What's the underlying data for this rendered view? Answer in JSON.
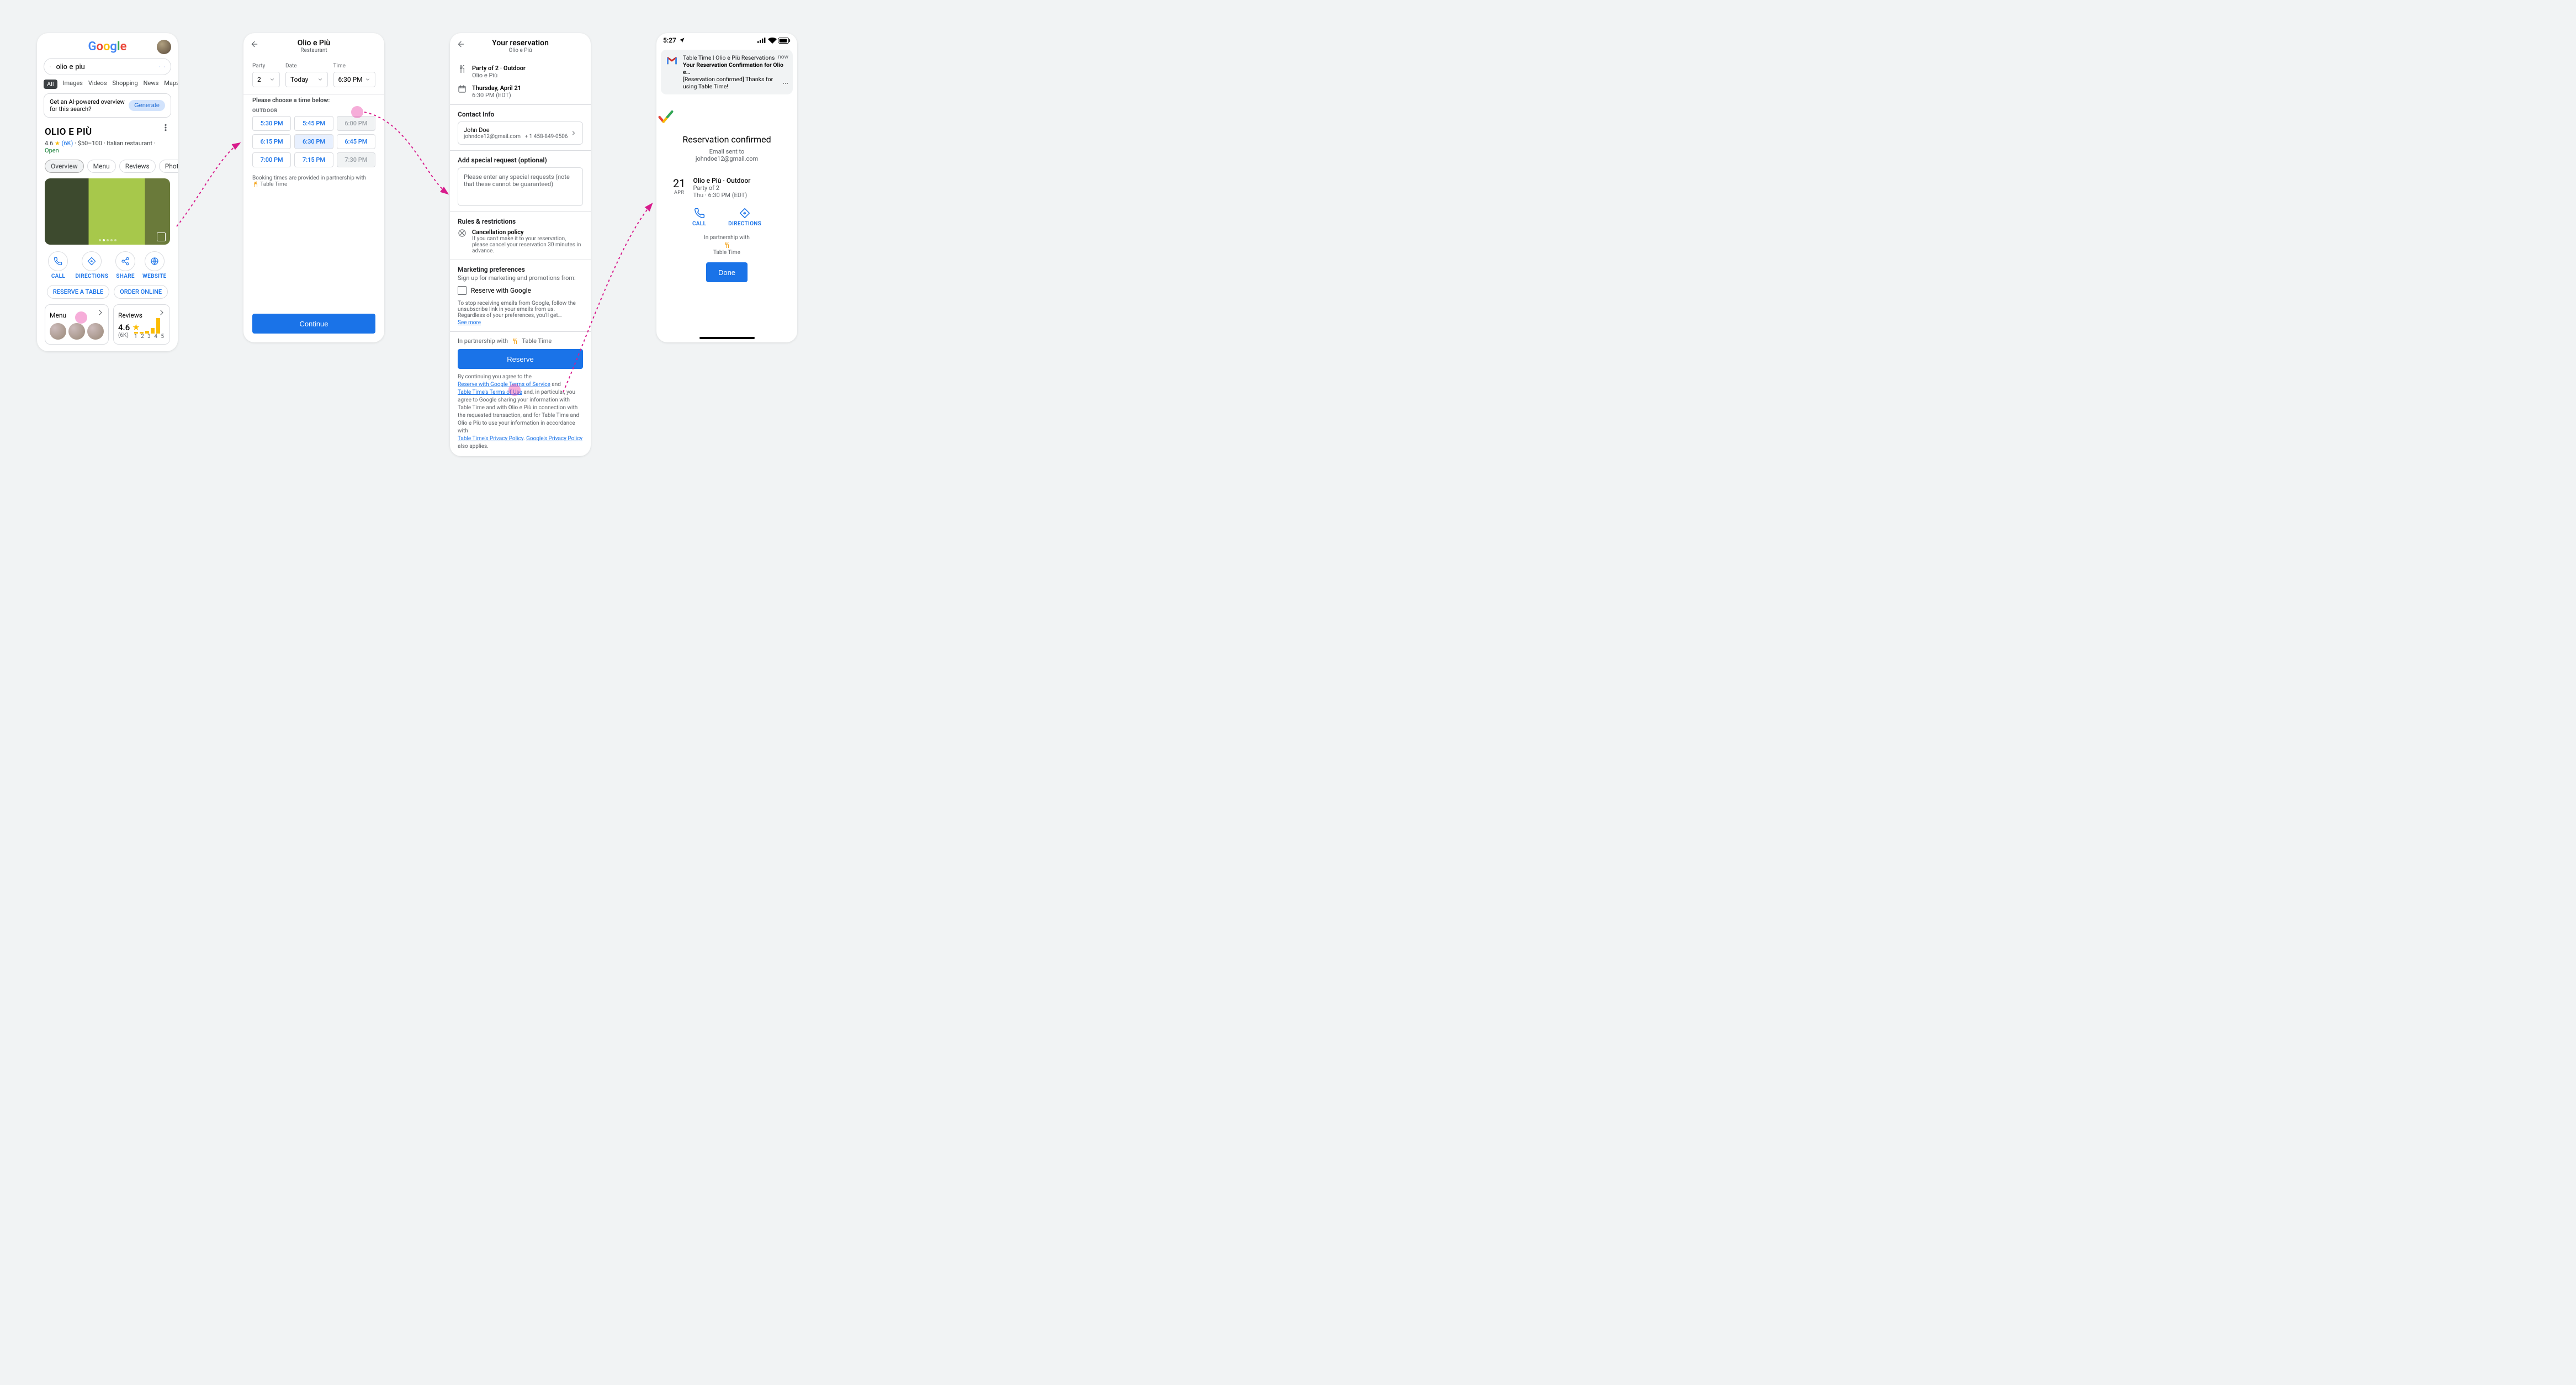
{
  "screens": {
    "search": {
      "query": "olio e piu",
      "tabs": [
        "All",
        "Images",
        "Videos",
        "Shopping",
        "News",
        "Maps"
      ],
      "ai_prompt": "Get an AI-powered overview for this search?",
      "ai_btn": "Generate",
      "name": "OLIO E PIÙ",
      "rating": "4.6",
      "star": "★",
      "reviews": "(6K)",
      "dot1": "·",
      "price": "$50–100",
      "dot2": "·",
      "cuisine": "Italian restaurant",
      "dot3": "·",
      "open": "Open",
      "tab_chips": [
        "Overview",
        "Menu",
        "Reviews",
        "Photos"
      ],
      "actions": [
        {
          "name": "call",
          "label": "CALL"
        },
        {
          "name": "directions",
          "label": "DIRECTIONS"
        },
        {
          "name": "share",
          "label": "SHARE"
        },
        {
          "name": "website",
          "label": "WEBSITE"
        }
      ],
      "cta1": "RESERVE A TABLE",
      "cta2": "ORDER ONLINE",
      "card_menu": "Menu",
      "card_reviews": "Reviews",
      "card_reviews_rating": "4.6",
      "card_reviews_count": "(6K)",
      "bar_labels": "1  2  3  4  5"
    },
    "pick": {
      "title": "Olio e Più",
      "subtitle": "Restaurant",
      "fields": {
        "party": "Party",
        "date": "Date",
        "time": "Time"
      },
      "values": {
        "party": "2",
        "date": "Today",
        "time": "6:30 PM"
      },
      "choose": "Please choose a time below:",
      "category": "OUTDOOR",
      "times": [
        {
          "t": "5:30 PM",
          "s": ""
        },
        {
          "t": "5:45 PM",
          "s": ""
        },
        {
          "t": "6:00 PM",
          "s": "dis"
        },
        {
          "t": "6:15 PM",
          "s": ""
        },
        {
          "t": "6:30 PM",
          "s": "sel"
        },
        {
          "t": "6:45 PM",
          "s": ""
        },
        {
          "t": "7:00 PM",
          "s": ""
        },
        {
          "t": "7:15 PM",
          "s": ""
        },
        {
          "t": "7:30 PM",
          "s": "dis"
        }
      ],
      "partner_line": "Booking times are provided in partnership with",
      "partner": "Table Time",
      "continue": "Continue"
    },
    "confirm": {
      "title": "Your reservation",
      "subtitle": "Olio e Più",
      "party_line": "Party of 2 · Outdoor",
      "rest_line": "Olio e Più",
      "date_line": "Thursday, April 21",
      "time_line": "6:30 PM (EDT)",
      "contact_hdr": "Contact Info",
      "contact_name": "John Doe",
      "contact_detail": "johndoe12@gmail.com   + 1 458-849-0506",
      "special_hdr": "Add special request (optional)",
      "special_ph": "Please enter any special requests (note that these cannot be guaranteed)",
      "rules_hdr": "Rules & restrictions",
      "cancel_title": "Cancellation policy",
      "cancel_text": "If you can't make it to your reservation, please cancel your reservation 30 minutes in advance.",
      "mkt_hdr": "Marketing preferences",
      "mkt_sub": "Sign up for marketing and promotions from:",
      "mkt_opt": "Reserve with Google",
      "mkt_note": "To stop receiving emails from Google, follow the unsubscribe link in your emails from us. Regardless of your preferences, you'll get…",
      "see_more": "See more",
      "partner_pre": "In partnership with",
      "partner": "Table Time",
      "reserve": "Reserve",
      "legal_lead": "By continuing you agree to the",
      "rwg_tos": "Reserve with Google Terms of Service",
      "and": " and",
      "tt_tos": "Table Time's Terms of Use",
      "legal_mid": " and, in particular, you agree to Google sharing your information with  Table Time and with Olio e Più in connection with the requested transaction, and for Table Time  and Olio e Più to use your information in accordance with ",
      "tt_pp": "Table Time's Privacy Policy",
      "sep": ". ",
      "g_pp": "Google's Privacy Policy",
      "legal_end": " also applies."
    },
    "done": {
      "status_time": "5:27",
      "notif_app": "Table Time | Olio e Più Reservations",
      "notif_when": "now",
      "notif_subj": "Your Reservation Confirmation for Olio e…",
      "notif_body": "[Reservation confirmed] Thanks for using Table Time!",
      "headline": "Reservation confirmed",
      "sent_to": "Email sent to",
      "email": "johndoe12@gmail.com",
      "day": "21",
      "mon": "APR",
      "d_title": "Olio e Più · Outdoor",
      "d_party": "Party of 2",
      "d_time": "Thu · 6:30 PM (EDT)",
      "call": "CALL",
      "directions": "DIRECTIONS",
      "partner_pre": "In partnership with",
      "partner": "Table Time",
      "done": "Done"
    }
  }
}
